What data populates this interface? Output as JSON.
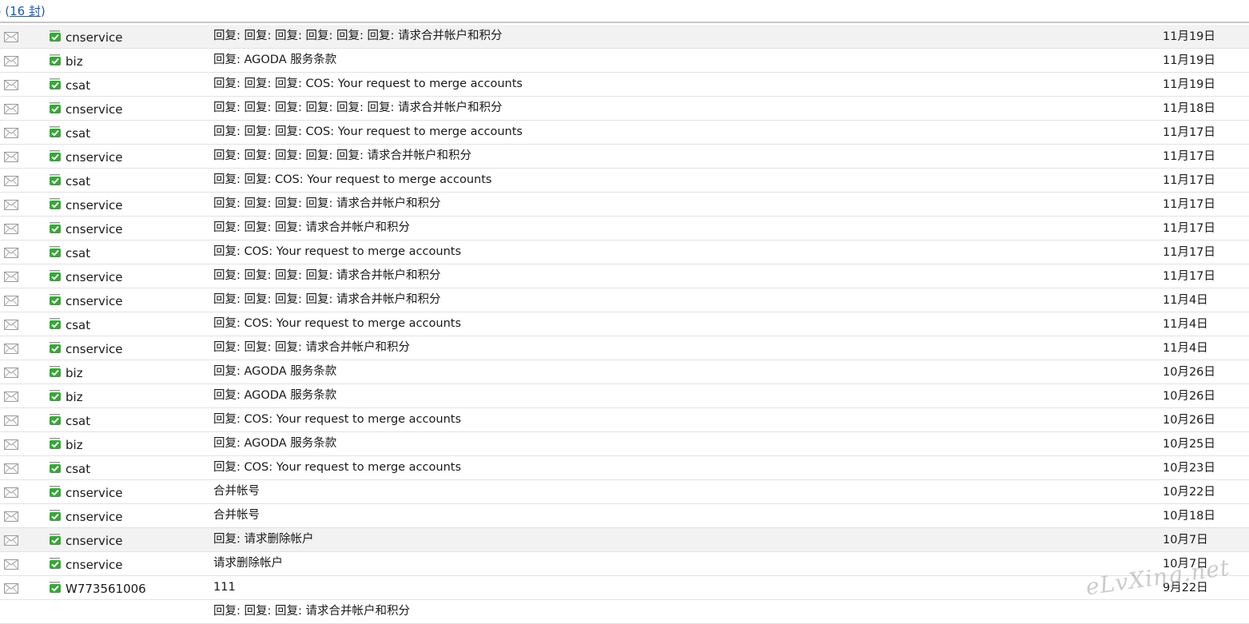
{
  "header": {
    "dash": "-",
    "open_paren": "(",
    "count_label": "16 封",
    "close_paren": ")"
  },
  "watermark": "eLvXing.net",
  "messages": [
    {
      "sender": "cnservice",
      "subject": "回复:  回复:  回复:  回复:  回复:  回复:  请求合并帐户和积分",
      "date": "11月19日",
      "highlight": true
    },
    {
      "sender": "biz",
      "subject": "回复: AGODA 服务条款",
      "date": "11月19日"
    },
    {
      "sender": "csat",
      "subject": "回复:  回复:  回复:  COS: Your request to merge accounts",
      "date": "11月19日"
    },
    {
      "sender": "cnservice",
      "subject": "回复:  回复:  回复:  回复:  回复:  回复:  请求合并帐户和积分",
      "date": "11月18日"
    },
    {
      "sender": "csat",
      "subject": "回复:  回复:  回复:  COS: Your request to merge accounts",
      "date": "11月17日"
    },
    {
      "sender": "cnservice",
      "subject": "回复:  回复:  回复:  回复:  回复:  请求合并帐户和积分",
      "date": "11月17日"
    },
    {
      "sender": "csat",
      "subject": "回复:  回复: COS: Your request to merge accounts",
      "date": "11月17日"
    },
    {
      "sender": "cnservice",
      "subject": "回复:  回复:  回复:  回复:  请求合并帐户和积分",
      "date": "11月17日"
    },
    {
      "sender": "cnservice",
      "subject": "回复:  回复:  回复:  请求合并帐户和积分",
      "date": "11月17日"
    },
    {
      "sender": "csat",
      "subject": "回复: COS: Your request to merge accounts",
      "date": "11月17日"
    },
    {
      "sender": "cnservice",
      "subject": "回复:  回复:  回复:  回复:  请求合并帐户和积分",
      "date": "11月17日"
    },
    {
      "sender": "cnservice",
      "subject": "回复:  回复:  回复:  回复:  请求合并帐户和积分",
      "date": "11月4日"
    },
    {
      "sender": "csat",
      "subject": "回复: COS: Your request to merge accounts",
      "date": "11月4日"
    },
    {
      "sender": "cnservice",
      "subject": "回复:  回复:  回复:  请求合并帐户和积分",
      "date": "11月4日"
    },
    {
      "sender": "biz",
      "subject": "回复: AGODA 服务条款",
      "date": "10月26日"
    },
    {
      "sender": "biz",
      "subject": "回复: AGODA 服务条款",
      "date": "10月26日"
    },
    {
      "sender": "csat",
      "subject": "回复: COS: Your request to merge accounts",
      "date": "10月26日"
    },
    {
      "sender": "biz",
      "subject": "回复: AGODA 服务条款",
      "date": "10月25日"
    },
    {
      "sender": "csat",
      "subject": "回复: COS: Your request to merge accounts",
      "date": "10月23日"
    },
    {
      "sender": "cnservice",
      "subject": "合并帐号",
      "date": "10月22日"
    },
    {
      "sender": "cnservice",
      "subject": "合并帐号",
      "date": "10月18日"
    },
    {
      "sender": "cnservice",
      "subject": "回复:  请求删除帐户",
      "date": "10月7日",
      "highlight": true
    },
    {
      "sender": "cnservice",
      "subject": "请求删除帐户",
      "date": "10月7日"
    },
    {
      "sender": "W773561006",
      "subject": "111",
      "date": "9月22日"
    },
    {
      "sender": "",
      "subject": "回复:  回复:  回复:  请求合并帐户和积分",
      "date": ""
    }
  ],
  "colors": {
    "accent_link": "#1e5aa8",
    "tag_green": "#3aa53a",
    "row_highlight": "#f2f2f2"
  },
  "icons": {
    "envelope": "envelope-icon",
    "tag": "verified-tag-icon"
  }
}
